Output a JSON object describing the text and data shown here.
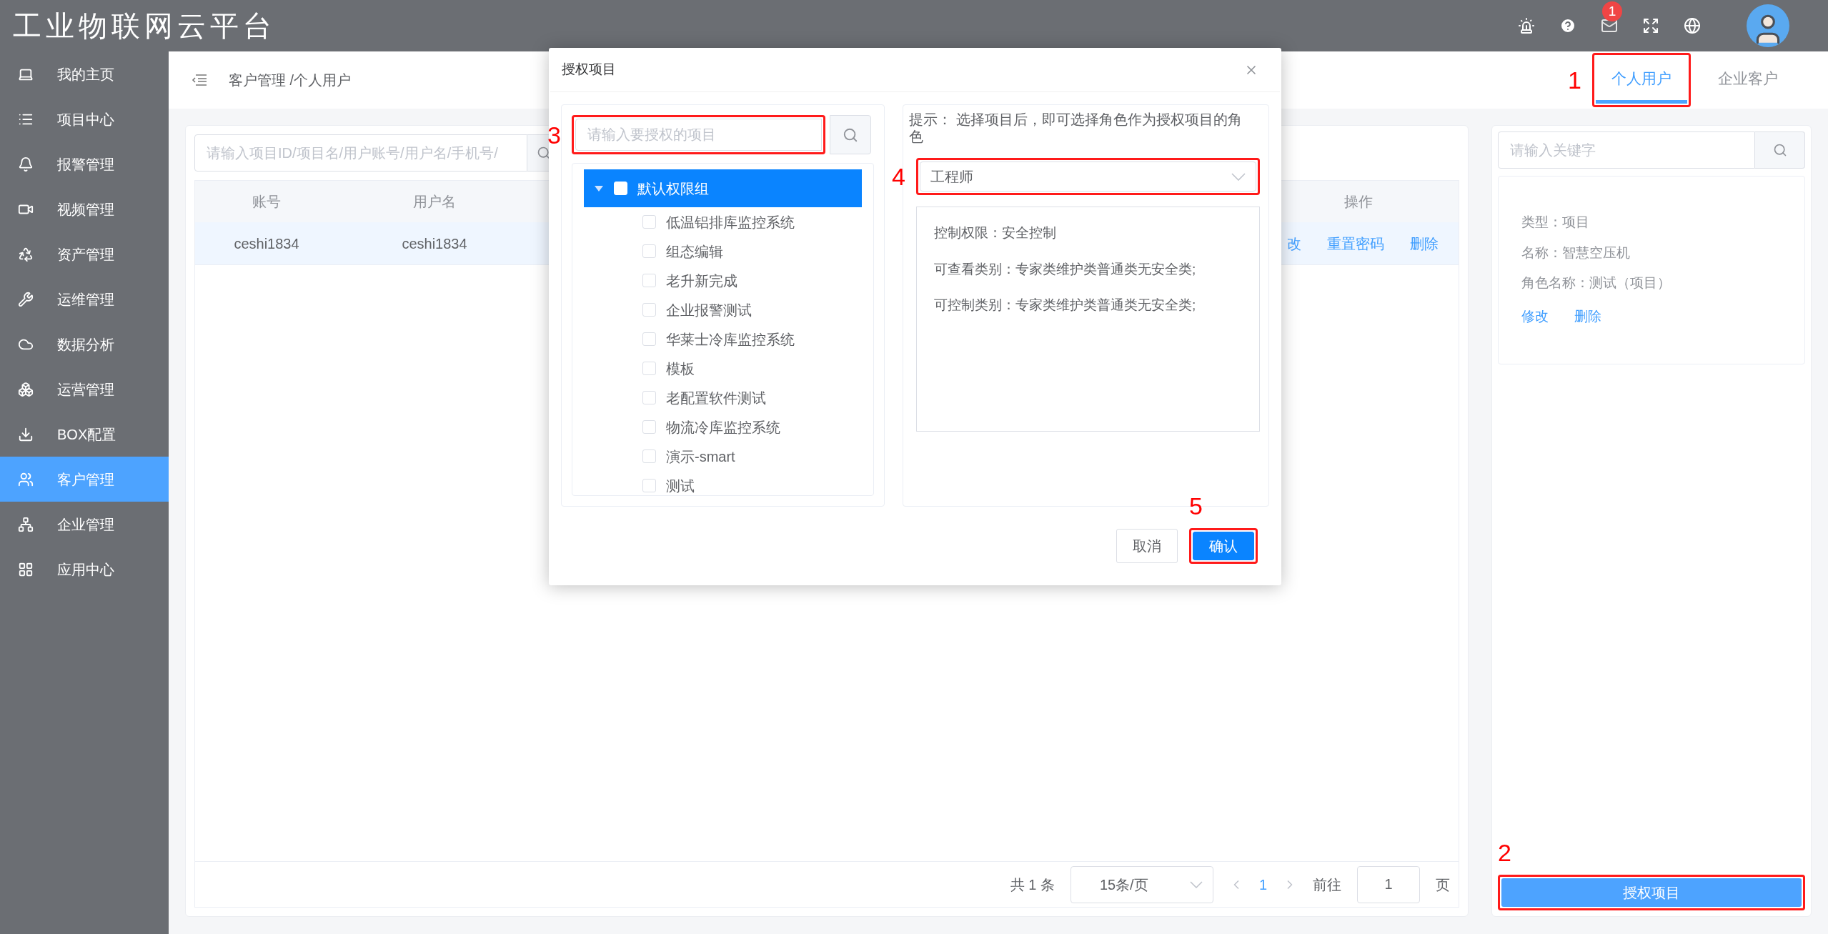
{
  "header": {
    "title": "工业物联网云平台",
    "mail_badge": "1"
  },
  "sidebar": {
    "items": [
      {
        "label": "我的主页",
        "selected": false
      },
      {
        "label": "项目中心",
        "selected": false
      },
      {
        "label": "报警管理",
        "selected": false
      },
      {
        "label": "视频管理",
        "selected": false
      },
      {
        "label": "资产管理",
        "selected": false
      },
      {
        "label": "运维管理",
        "selected": false
      },
      {
        "label": "数据分析",
        "selected": false
      },
      {
        "label": "运营管理",
        "selected": false
      },
      {
        "label": "BOX配置",
        "selected": false
      },
      {
        "label": "客户管理",
        "selected": true
      },
      {
        "label": "企业管理",
        "selected": false
      },
      {
        "label": "应用中心",
        "selected": false
      }
    ]
  },
  "breadcrumb": "客户管理 /个人用户",
  "tabs": [
    {
      "label": "个人用户",
      "selected": true,
      "callout": "1"
    },
    {
      "label": "企业客户",
      "selected": false
    }
  ],
  "search": {
    "placeholder": "请输入项目ID/项目名/用户账号/用户名/手机号/"
  },
  "table": {
    "columns": [
      "账号",
      "用户名",
      "操作"
    ],
    "rows": [
      {
        "cells": [
          "ceshi1834",
          "ceshi1834"
        ],
        "actions": [
          "改",
          "重置密码",
          "删除"
        ]
      }
    ]
  },
  "pagination": {
    "total": "共 1 条",
    "page_size": "15条/页",
    "current_page": "1",
    "goto_label": "前往",
    "goto_value": "1",
    "page_suffix": "页"
  },
  "detail": {
    "search_placeholder": "请输入关键字",
    "lines": [
      "类型：项目",
      "名称：智慧空压机",
      "角色名称：测试（项目）"
    ],
    "links": [
      "修改",
      "删除"
    ],
    "button": {
      "label": "授权项目",
      "callout": "2"
    }
  },
  "dialog": {
    "title": "授权项目",
    "search": {
      "placeholder": "请输入要授权的项目",
      "callout": "3"
    },
    "tree": [
      {
        "label": "默认权限组",
        "expanded": true,
        "selected": true,
        "checked": false,
        "children": [
          {
            "label": "低温铝排库监控系统",
            "checked": false
          },
          {
            "label": "组态编辑",
            "checked": false
          },
          {
            "label": "老升新完成",
            "checked": false
          },
          {
            "label": "企业报警测试",
            "checked": false
          },
          {
            "label": "华莱士冷库监控系统",
            "checked": false
          },
          {
            "label": "模板",
            "checked": false
          },
          {
            "label": "老配置软件测试",
            "checked": false
          },
          {
            "label": "物流冷库监控系统",
            "checked": false
          },
          {
            "label": "演示-smart",
            "checked": false
          },
          {
            "label": "测试",
            "checked": false
          }
        ]
      }
    ],
    "hint": "提示： 选择项目后，即可选择角色作为授权项目的角色",
    "role_select": {
      "value": "工程师",
      "callout": "4"
    },
    "role_info": [
      "控制权限：安全控制",
      "可查看类别：专家类维护类普通类无安全类;",
      "可控制类别：专家类维护类普通类无安全类;"
    ],
    "buttons": [
      {
        "label": "取消",
        "kind": "default"
      },
      {
        "label": "确认",
        "kind": "primary",
        "callout": "5"
      }
    ]
  }
}
